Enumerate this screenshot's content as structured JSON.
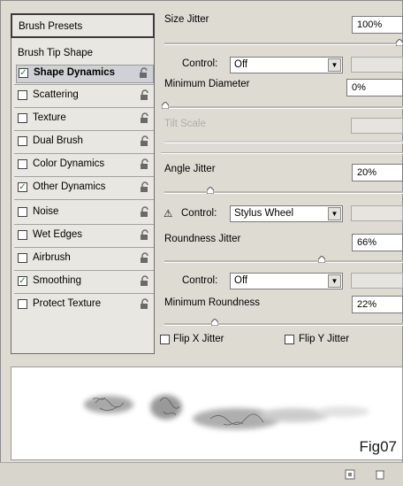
{
  "left_panel": {
    "presets_label": "Brush Presets",
    "tip_label": "Brush Tip Shape",
    "items": [
      {
        "label": "Shape Dynamics",
        "checked": true,
        "selected": true
      },
      {
        "label": "Scattering",
        "checked": false
      },
      {
        "label": "Texture",
        "checked": false
      },
      {
        "label": "Dual Brush",
        "checked": false
      },
      {
        "label": "Color Dynamics",
        "checked": false
      },
      {
        "label": "Other Dynamics",
        "checked": true
      },
      {
        "label": "Noise",
        "checked": false
      },
      {
        "label": "Wet Edges",
        "checked": false
      },
      {
        "label": "Airbrush",
        "checked": false
      },
      {
        "label": "Smoothing",
        "checked": true
      },
      {
        "label": "Protect Texture",
        "checked": false
      }
    ],
    "check_glyph": "✓"
  },
  "right_panel": {
    "size_jitter_label": "Size Jitter",
    "size_jitter_value": "100%",
    "control_label": "Control:",
    "control1_value": "Off",
    "min_diameter_label": "Minimum Diameter",
    "min_diameter_value": "0%",
    "tilt_scale_label": "Tilt Scale",
    "angle_jitter_label": "Angle Jitter",
    "angle_jitter_value": "20%",
    "control2_value": "Stylus Wheel",
    "roundness_jitter_label": "Roundness Jitter",
    "roundness_jitter_value": "66%",
    "control3_value": "Off",
    "min_roundness_label": "Minimum Roundness",
    "min_roundness_value": "22%",
    "flip_x_label": "Flip X Jitter",
    "flip_y_label": "Flip Y Jitter",
    "warning_glyph": "⚠"
  },
  "preview": {
    "caption": "Fig07"
  }
}
